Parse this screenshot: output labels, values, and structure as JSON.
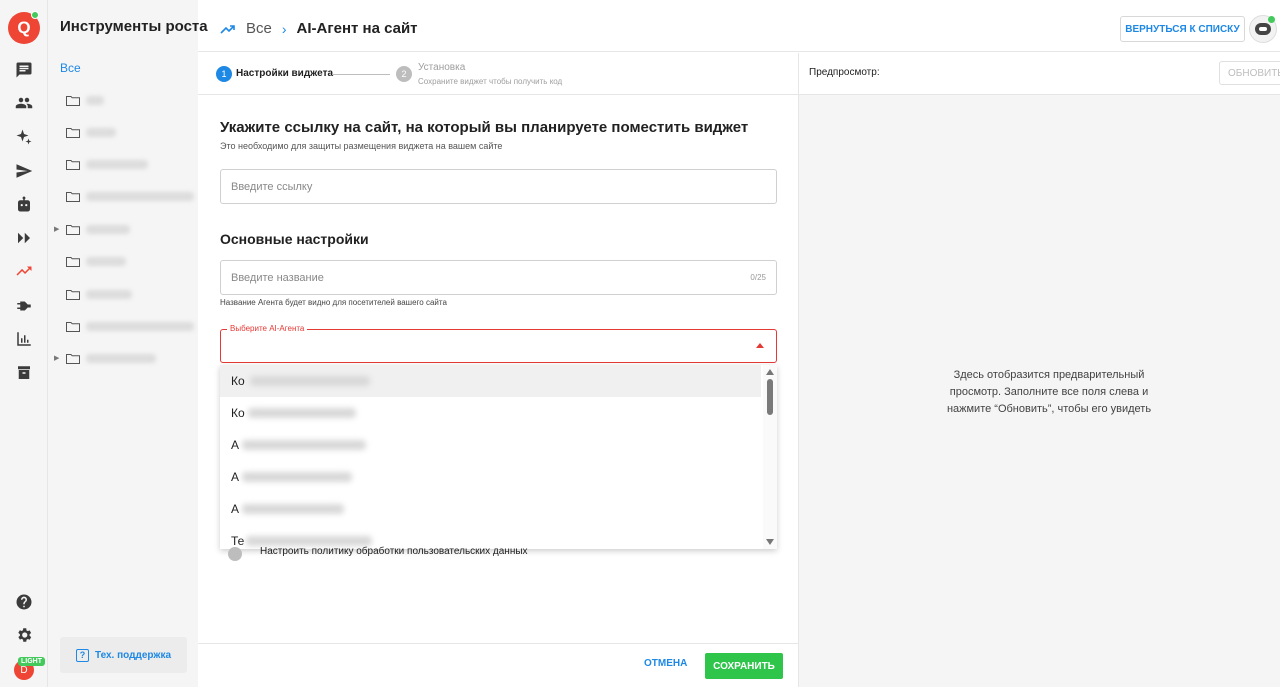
{
  "brand": {
    "accent": "#ee4535",
    "link": "#1e88e5",
    "success": "#2ec54a"
  },
  "rail": {
    "logo_letter": "Q",
    "icons": [
      "chat-icon",
      "users-icon",
      "sparkle-icon",
      "send-icon",
      "robot-icon",
      "double-chevron-icon",
      "trending-up-icon",
      "plug-icon",
      "bar-chart-icon",
      "archive-icon",
      "help-icon",
      "settings-icon"
    ],
    "user_initial": "D",
    "plan_badge": "LIGHT"
  },
  "sidebar": {
    "title": "Инструменты роста",
    "all_label": "Все",
    "support_label": "Тех. поддержка"
  },
  "header": {
    "crumb_root": "Все",
    "crumb_sep": "›",
    "crumb_current": "AI-Агент на сайт",
    "back_button": "ВЕРНУТЬСЯ К СПИСКУ"
  },
  "stepper": {
    "step1_num": "1",
    "step1_label": "Настройки виджета",
    "step2_num": "2",
    "step2_label": "Установка",
    "step2_sub": "Сохраните виджет чтобы получить код"
  },
  "form": {
    "site_heading": "Укажите ссылку на сайт, на который вы планируете поместить виджет",
    "site_sub": "Это необходимо для защиты размещения виджета на вашем сайте",
    "site_placeholder": "Введите ссылку",
    "main_heading": "Основные настройки",
    "name_placeholder": "Введите название",
    "name_counter": "0/25",
    "name_hint": "Название Агента будет видно для посетителей вашего сайта",
    "agent_select_label": "Выберите AI-Агента",
    "agent_options": [
      "Ко",
      "Ко",
      "А",
      "А",
      "А",
      "Те"
    ],
    "privacy_toggle_label": "Настроить политику обработки пользовательских данных"
  },
  "footer": {
    "cancel": "ОТМЕНА",
    "save": "СОХРАНИТЬ"
  },
  "preview": {
    "title": "Предпросмотр:",
    "refresh": "ОБНОВИТЬ",
    "message": "Здесь отобразится предварительный просмотр. Заполните все поля слева и нажмите “Обновить”, чтобы его увидеть"
  }
}
